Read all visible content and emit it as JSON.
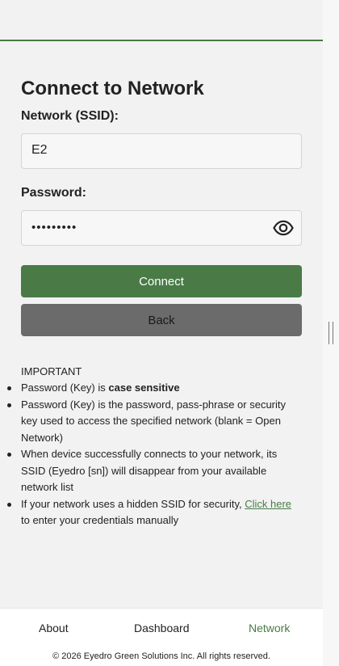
{
  "title": "Connect to Network",
  "ssid": {
    "label": "Network (SSID):",
    "value": "E2"
  },
  "password": {
    "label": "Password:",
    "value": "•••••••••"
  },
  "buttons": {
    "connect": "Connect",
    "back": "Back"
  },
  "important": {
    "heading": "IMPORTANT",
    "item1_prefix": "Password (Key) is ",
    "item1_strong": "case sensitive",
    "item2": "Password (Key) is the password, pass-phrase or security key used to access the specified network (blank = Open Network)",
    "item3": "When device successfully connects to your network, its SSID (Eyedro [sn]) will disappear from your available network list",
    "item4_prefix": "If your network uses a hidden SSID for security, ",
    "item4_link": "Click here",
    "item4_suffix": " to enter your credentials manually"
  },
  "footer": {
    "nav": {
      "about": "About",
      "dashboard": "Dashboard",
      "network": "Network"
    },
    "copyright": "© 2026 Eyedro Green Solutions Inc. All rights reserved."
  },
  "colors": {
    "accent": "#4a7b47",
    "back_button": "#6b6b6b",
    "background": "#f2f2f2"
  },
  "icons": {
    "password_toggle": "eye-icon"
  }
}
